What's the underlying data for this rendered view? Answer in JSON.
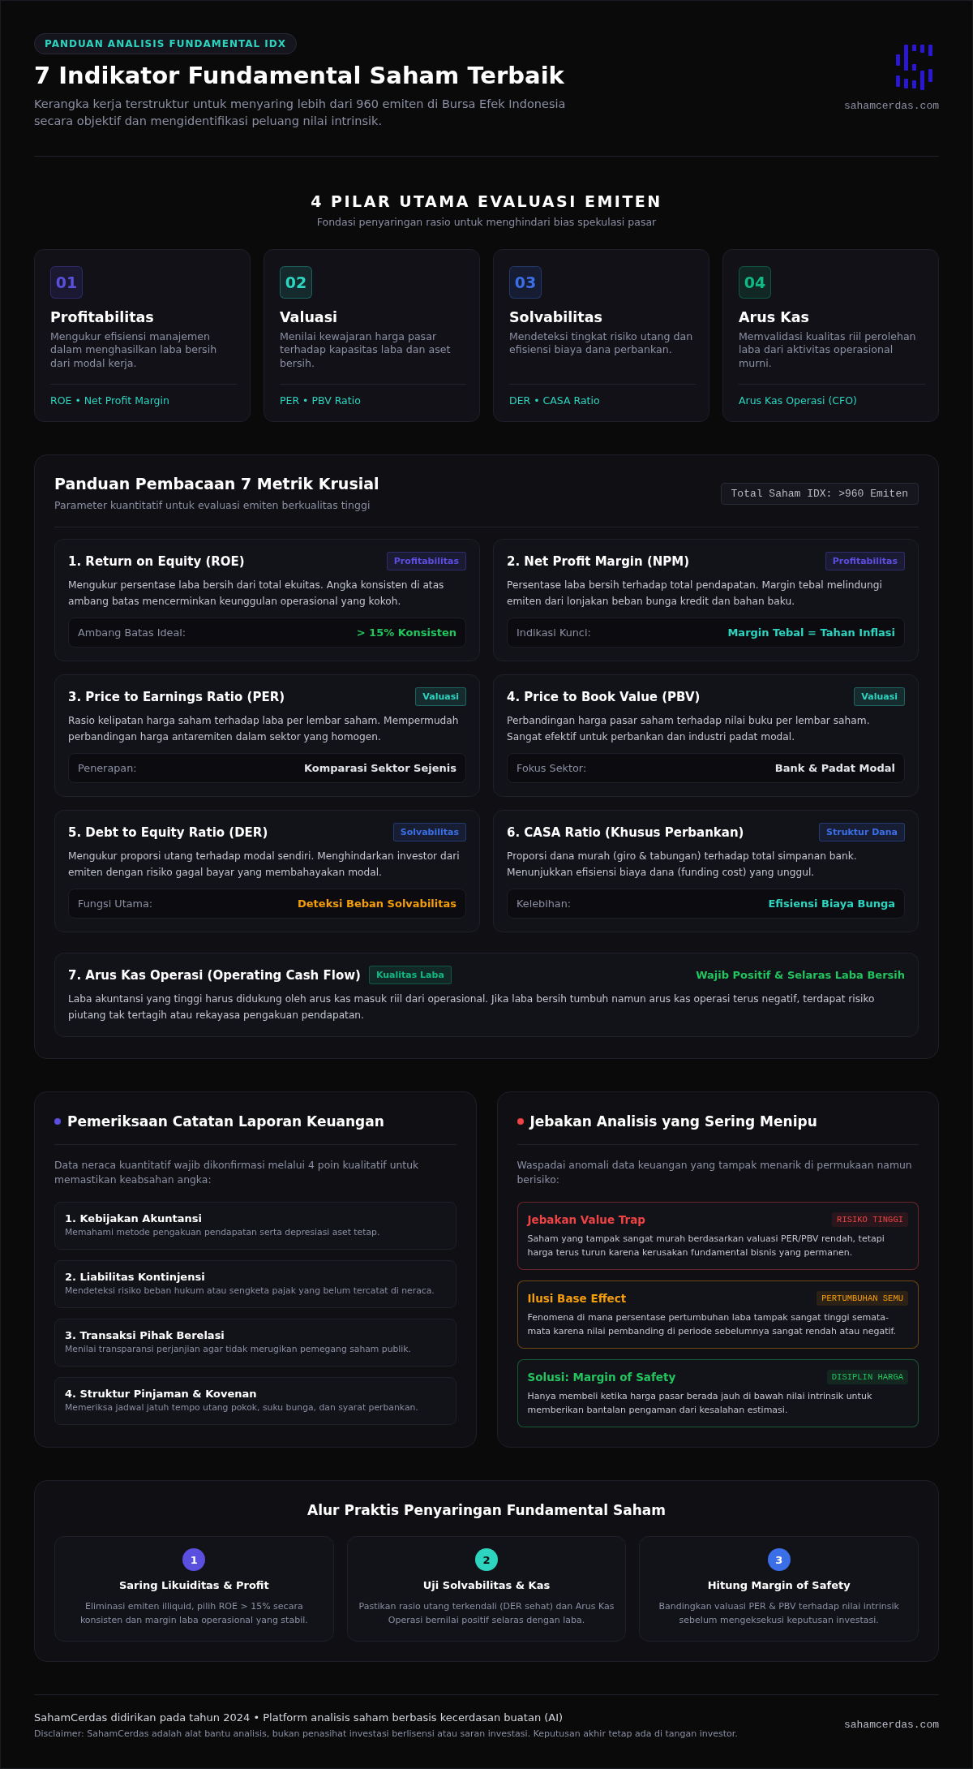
{
  "header": {
    "badge": "PANDUAN ANALISIS FUNDAMENTAL IDX",
    "title": "7 Indikator Fundamental Saham Terbaik",
    "subtitle": "Kerangka kerja terstruktur untuk menyaring lebih dari 960 emiten di Bursa Efek Indonesia secara objektif dan mengidentifikasi peluang nilai intrinsik.",
    "site": "sahamcerdas.com"
  },
  "pillars": {
    "title": "4 PILAR UTAMA EVALUASI EMITEN",
    "subtitle": "Fondasi penyaringan rasio untuk menghindari bias spekulasi pasar",
    "items": [
      {
        "number": "01",
        "color": "#5b4fe0",
        "title": "Profitabilitas",
        "description": "Mengukur efisiensi manajemen dalam menghasilkan laba bersih dari modal kerja.",
        "metrics": "ROE • Net Profit Margin"
      },
      {
        "number": "02",
        "color": "#2dd4bf",
        "title": "Valuasi",
        "description": "Menilai kewajaran harga pasar terhadap kapasitas laba dan aset bersih.",
        "metrics": "PER • PBV Ratio"
      },
      {
        "number": "03",
        "color": "#3b6fe8",
        "title": "Solvabilitas",
        "description": "Mendeteksi tingkat risiko utang dan efisiensi biaya dana perbankan.",
        "metrics": "DER • CASA Ratio"
      },
      {
        "number": "04",
        "color": "#10b981",
        "title": "Arus Kas",
        "description": "Memvalidasi kualitas riil perolehan laba dari aktivitas operasional murni.",
        "metrics": "Arus Kas Operasi (CFO)"
      }
    ]
  },
  "metrics": {
    "title": "Panduan Pembacaan 7 Metrik Krusial",
    "subtitle": "Parameter kuantitatif untuk evaluasi emiten berkualitas tinggi",
    "badge": "Total Saham IDX: >960 Emiten",
    "items": [
      {
        "kind": "standard",
        "title": "1. Return on Equity (ROE)",
        "tag": {
          "label": "Profitabilitas",
          "color": "#5b4fe0"
        },
        "description": "Mengukur persentase laba bersih dari total ekuitas. Angka konsisten di atas ambang batas mencerminkan keunggulan operasional yang kokoh.",
        "label": "Ambang Batas Ideal:",
        "value": {
          "text": "> 15% Konsisten",
          "color": "#22c55e"
        }
      },
      {
        "kind": "standard",
        "title": "2. Net Profit Margin (NPM)",
        "tag": {
          "label": "Profitabilitas",
          "color": "#5b4fe0"
        },
        "description": "Persentase laba bersih terhadap total pendapatan. Margin tebal melindungi emiten dari lonjakan beban bunga kredit dan bahan baku.",
        "label": "Indikasi Kunci:",
        "value": {
          "text": "Margin Tebal = Tahan Inflasi",
          "color": "#2dd4bf"
        }
      },
      {
        "kind": "standard",
        "title": "3. Price to Earnings Ratio (PER)",
        "tag": {
          "label": "Valuasi",
          "color": "#2dd4bf"
        },
        "description": "Rasio kelipatan harga saham terhadap laba per lembar saham. Mempermudah perbandingan harga antaremiten dalam sektor yang homogen.",
        "label": "Penerapan:",
        "value": {
          "text": "Komparasi Sektor Sejenis",
          "color": "#e2e4ea"
        }
      },
      {
        "kind": "standard",
        "title": "4. Price to Book Value (PBV)",
        "tag": {
          "label": "Valuasi",
          "color": "#2dd4bf"
        },
        "description": "Perbandingan harga pasar saham terhadap nilai buku per lembar saham. Sangat efektif untuk perbankan dan industri padat modal.",
        "label": "Fokus Sektor:",
        "value": {
          "text": "Bank & Padat Modal",
          "color": "#e2e4ea"
        }
      },
      {
        "kind": "standard",
        "title": "5. Debt to Equity Ratio (DER)",
        "tag": {
          "label": "Solvabilitas",
          "color": "#3b6fe8"
        },
        "description": "Mengukur proporsi utang terhadap modal sendiri. Menghindarkan investor dari emiten dengan risiko gagal bayar yang membahayakan modal.",
        "label": "Fungsi Utama:",
        "value": {
          "text": "Deteksi Beban Solvabilitas",
          "color": "#f59e0b"
        }
      },
      {
        "kind": "standard",
        "title": "6. CASA Ratio (Khusus Perbankan)",
        "tag": {
          "label": "Struktur Dana",
          "color": "#3b6fe8"
        },
        "description": "Proporsi dana murah (giro & tabungan) terhadap total simpanan bank. Menunjukkan efisiensi biaya dana (funding cost) yang unggul.",
        "label": "Kelebihan:",
        "value": {
          "text": "Efisiensi Biaya Bunga",
          "color": "#2dd4bf"
        }
      },
      {
        "kind": "wide",
        "title": "7. Arus Kas Operasi (Operating Cash Flow)",
        "tag": {
          "label": "Kualitas Laba",
          "color": "#10b981"
        },
        "description": "Laba akuntansi yang tinggi harus didukung oleh arus kas masuk riil dari operasional. Jika laba bersih tumbuh namun arus kas operasi terus negatif, terdapat risiko piutang tak tertagih atau rekayasa pengakuan pendapatan.",
        "value": {
          "text": "Wajib Positif & Selaras Laba Bersih",
          "color": "#22c55e"
        }
      }
    ]
  },
  "checks": {
    "title": "Pemeriksaan Catatan Laporan Keuangan",
    "dot": {
      "color": "#5b4fe0"
    },
    "intro": "Data neraca kuantitatif wajib dikonfirmasi melalui 4 poin kualitatif untuk memastikan keabsahan angka:",
    "items": [
      {
        "title": "1. Kebijakan Akuntansi",
        "description": "Memahami metode pengakuan pendapatan serta depresiasi aset tetap."
      },
      {
        "title": "2. Liabilitas Kontinjensi",
        "description": "Mendeteksi risiko beban hukum atau sengketa pajak yang belum tercatat di neraca."
      },
      {
        "title": "3. Transaksi Pihak Berelasi",
        "description": "Menilai transparansi perjanjian agar tidak merugikan pemegang saham publik."
      },
      {
        "title": "4. Struktur Pinjaman & Kovenan",
        "description": "Memeriksa jadwal jatuh tempo utang pokok, suku bunga, dan syarat perbankan."
      }
    ]
  },
  "traps": {
    "title": "Jebakan Analisis yang Sering Menipu",
    "dot": {
      "color": "#ef4444"
    },
    "intro": "Waspadai anomali data keuangan yang tampak menarik di permukaan namun berisiko:",
    "items": [
      {
        "title": "Jebakan Value Trap",
        "tag": "RISIKO TINGGI",
        "color": "#ef4444",
        "description": "Saham yang tampak sangat murah berdasarkan valuasi PER/PBV rendah, tetapi harga terus turun karena kerusakan fundamental bisnis yang permanen."
      },
      {
        "title": "Ilusi Base Effect",
        "tag": "PERTUMBUHAN SEMU",
        "color": "#f59e0b",
        "description": "Fenomena di mana persentase pertumbuhan laba tampak sangat tinggi semata-mata karena nilai pembanding di periode sebelumnya sangat rendah atau negatif."
      },
      {
        "title": "Solusi: Margin of Safety",
        "tag": "DISIPLIN HARGA",
        "color": "#22c55e",
        "description": "Hanya membeli ketika harga pasar berada jauh di bawah nilai intrinsik untuk memberikan bantalan pengaman dari kesalahan estimasi."
      }
    ]
  },
  "flow": {
    "title": "Alur Praktis Penyaringan Fundamental Saham",
    "steps": [
      {
        "number": "1",
        "color": "#5b4fe0",
        "title": "Saring Likuiditas & Profit",
        "description": "Eliminasi emiten illiquid, pilih ROE > 15% secara konsisten dan margin laba operasional yang stabil."
      },
      {
        "number": "2",
        "color": "#2dd4bf",
        "title": "Uji Solvabilitas & Kas",
        "description": "Pastikan rasio utang terkendali (DER sehat) dan Arus Kas Operasi bernilai positif selaras dengan laba."
      },
      {
        "number": "3",
        "color": "#3b6fe8",
        "title": "Hitung Margin of Safety",
        "description": "Bandingkan valuasi PER & PBV terhadap nilai intrinsik sebelum mengeksekusi keputusan investasi."
      }
    ]
  },
  "footer": {
    "about": "SahamCerdas didirikan pada tahun 2024 • Platform analisis saham berbasis kecerdasan buatan (AI)",
    "disclaimer": "Disclaimer: SahamCerdas adalah alat bantu analisis, bukan penasihat investasi berlisensi atau saran investasi. Keputusan akhir tetap ada di tangan investor.",
    "site": "sahamcerdas.com"
  }
}
